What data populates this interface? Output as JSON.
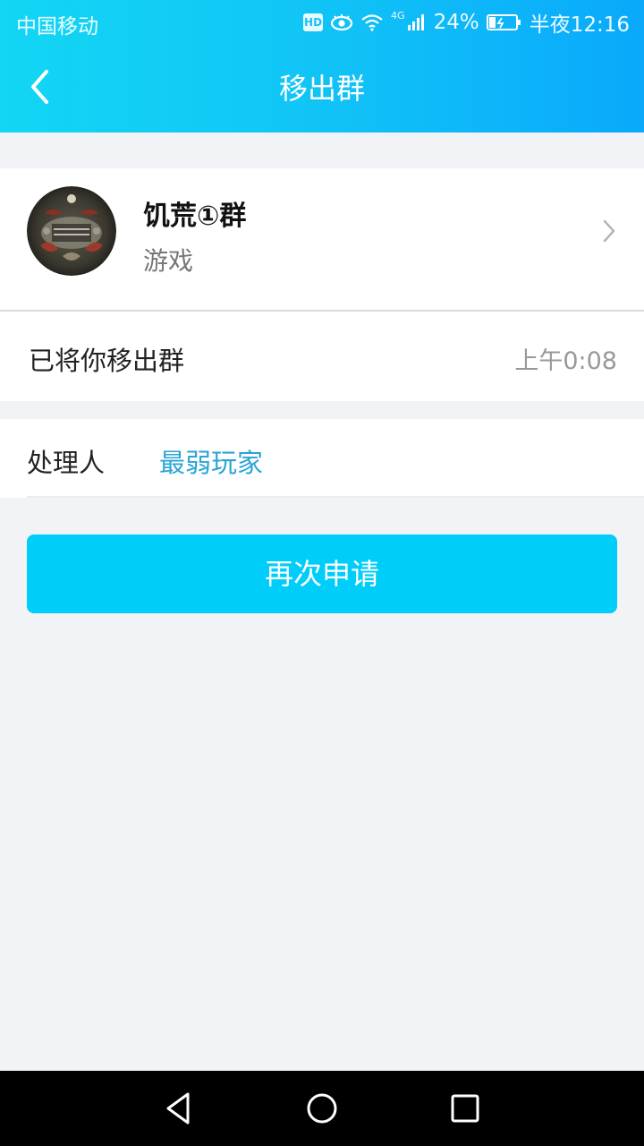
{
  "status_bar": {
    "carrier": "中国移动",
    "hd": "HD",
    "network": "4G",
    "battery": "24%",
    "time": "半夜12:16"
  },
  "header": {
    "title": "移出群"
  },
  "group": {
    "name": "饥荒①群",
    "category": "游戏"
  },
  "message": {
    "text": "已将你移出群",
    "time": "上午0:08"
  },
  "handler": {
    "label": "处理人",
    "name": "最弱玩家"
  },
  "actions": {
    "reapply_label": "再次申请"
  },
  "colors": {
    "header_start": "#12d6f4",
    "header_end": "#0aa9fb",
    "button": "#00cdf9",
    "link": "#2aa4d6",
    "background": "#f2f3f7"
  },
  "icons": {
    "back": "chevron-left-icon",
    "card_arrow": "chevron-right-icon",
    "nav_back": "triangle-back-icon",
    "nav_home": "circle-home-icon",
    "nav_recent": "square-recent-icon"
  }
}
